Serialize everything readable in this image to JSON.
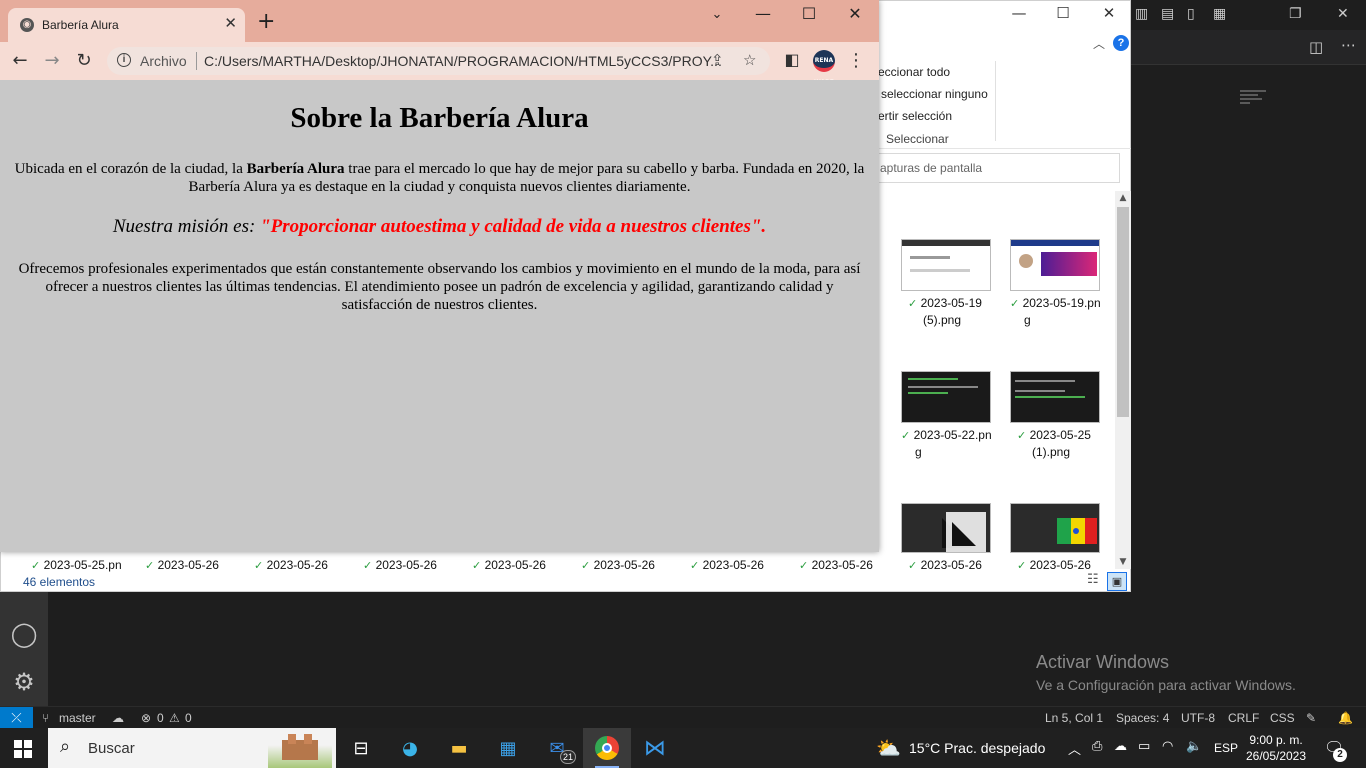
{
  "chrome": {
    "tab_title": "Barbería Alura",
    "omnibox_scheme_label": "Archivo",
    "omnibox_url": "C:/Users/MARTHA/Desktop/JHONATAN/PROGRAMACION/HTML5yCCS3/PROY...",
    "profile_label": "RENA WARE",
    "page": {
      "heading": "Sobre la Barbería Alura",
      "p1_a": "Ubicada en el corazón de la ciudad, la ",
      "p1_bold": "Barbería Alura",
      "p1_b": " trae para el mercado lo que hay de mejor para su cabello y barba. Fundada en 2020, la Barbería Alura ya es destaque en la ciudad y conquista nuevos clientes diariamente.",
      "mission_label": "Nuestra misión es: ",
      "mission_quote": "\"Proporcionar autoestima y calidad de vida a nuestros clientes\".",
      "p2": "Ofrecemos profesionales experimentados que están constantemente observando los cambios y movimiento en el mundo de la moda, para así ofrecer a nuestros clientes las últimas tendencias. El atendimiento posee un padrón de excelencia y agilidad, garantizando calidad y satisfacción de nuestros clientes."
    }
  },
  "explorer": {
    "ribbon": {
      "select_all": "eccionar todo",
      "select_none": "seleccionar ninguno",
      "invert_selection": "ertir selección",
      "group_label": "Seleccionar"
    },
    "search_placeholder": "apturas de pantalla",
    "thumbnails": [
      {
        "line1": "2023-05-19",
        "line2": "(5).png"
      },
      {
        "line1": "2023-05-19.pn",
        "line2": "g"
      },
      {
        "line1": "2023-05-22.pn",
        "line2": "g"
      },
      {
        "line1": "2023-05-25",
        "line2": "(1).png"
      }
    ],
    "bottom_row": [
      "2023-05-25.pn",
      "2023-05-26",
      "2023-05-26",
      "2023-05-26",
      "2023-05-26",
      "2023-05-26",
      "2023-05-26",
      "2023-05-26",
      "2023-05-26",
      "2023-05-26"
    ],
    "item_count": "46 elementos"
  },
  "vscode": {
    "watermark_title": "Activar Windows",
    "watermark_sub": "Ve a Configuración para activar Windows.",
    "status": {
      "branch": "master",
      "errors": "0",
      "warnings": "0",
      "position": "Ln 5, Col 1",
      "spaces": "Spaces: 4",
      "encoding": "UTF-8",
      "eol": "CRLF",
      "language": "CSS"
    }
  },
  "taskbar": {
    "search_label": "Buscar",
    "mail_badge": "21",
    "weather": "15°C  Prac. despejado",
    "language": "ESP",
    "time": "9:00 p. m.",
    "date": "26/05/2023",
    "notifications": "2"
  }
}
